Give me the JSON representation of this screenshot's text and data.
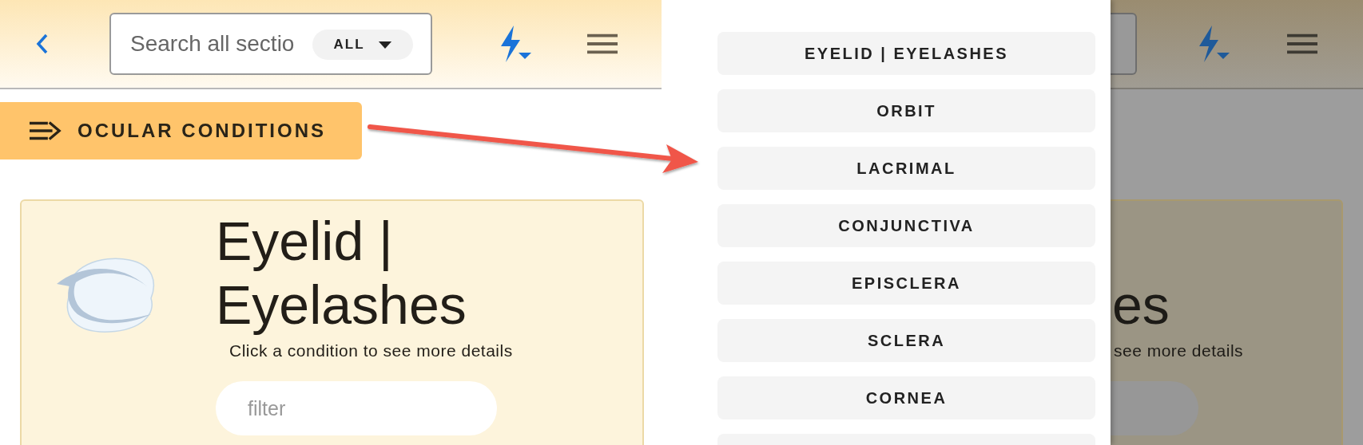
{
  "header": {
    "search": {
      "placeholder": "Search all sectio",
      "scope": "ALL"
    }
  },
  "section_button": {
    "label": "OCULAR CONDITIONS"
  },
  "card": {
    "title": "Eyelid | Eyelashes",
    "subtitle": "Click a condition to see more details",
    "filter": {
      "placeholder": "filter"
    }
  },
  "menu": {
    "items": [
      {
        "label": "EYELID | EYELASHES"
      },
      {
        "label": "ORBIT"
      },
      {
        "label": "LACRIMAL"
      },
      {
        "label": "CONJUNCTIVA"
      },
      {
        "label": "EPISCLERA"
      },
      {
        "label": "SCLERA"
      },
      {
        "label": "CORNEA"
      }
    ]
  },
  "background": {
    "title_part": "es",
    "subtitle_part": "see more details"
  }
}
